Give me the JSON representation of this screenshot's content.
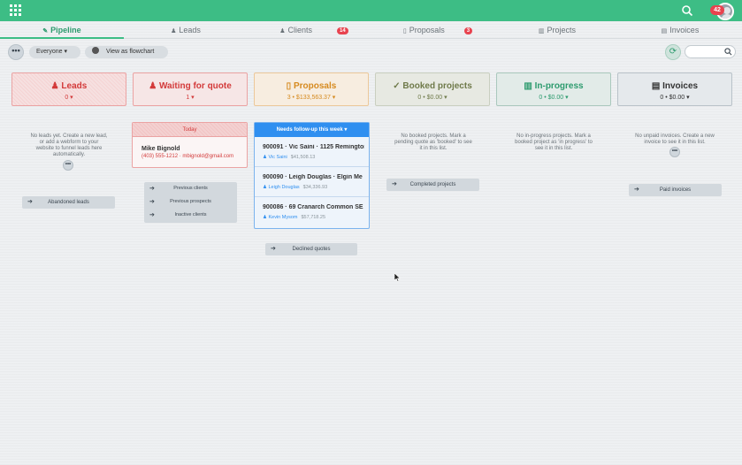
{
  "header": {
    "notification_count": "42",
    "icons": {
      "apps": "grid-icon",
      "search": "search-icon",
      "avatar": "user-avatar"
    },
    "colors": {
      "brand": "#3dbd85",
      "danger": "#e8434f",
      "info": "#2f8ff0"
    }
  },
  "tabs": [
    {
      "label": "Pipeline",
      "icon": "pipeline-icon",
      "active": true
    },
    {
      "label": "Leads",
      "icon": "person-icon"
    },
    {
      "label": "Clients",
      "icon": "person-icon",
      "badge": "14"
    },
    {
      "label": "Proposals",
      "icon": "document-icon",
      "badge": "3"
    },
    {
      "label": "Projects",
      "icon": "building-icon"
    },
    {
      "label": "Invoices",
      "icon": "document-icon"
    }
  ],
  "toolbar": {
    "more_label": "•••",
    "everyone_label": "Everyone ▾",
    "flowchart_label": "View as flowchart"
  },
  "stages": {
    "leads": {
      "name": "Leads",
      "value": "0 ▾"
    },
    "waiting": {
      "name": "Waiting for quote",
      "value": "1 ▾"
    },
    "proposals": {
      "name": "Proposals",
      "value": "3 • $133,563.37 ▾"
    },
    "booked": {
      "name": "Booked projects",
      "value": "0 • $0.00 ▾"
    },
    "progress": {
      "name": "In-progress",
      "value": "0 • $0.00 ▾"
    },
    "invoices": {
      "name": "Invoices",
      "value": "0 • $0.00 ▾"
    }
  },
  "leads_col": {
    "empty": "No leads yet. Create a new lead, or add a webform to your website to funnel leads here automatically.",
    "abandoned": "Abandoned leads"
  },
  "waiting_col": {
    "today": "Today",
    "name": "Mike Bignold",
    "contact": "(403) 555-1212 · mbignold@gmail.com",
    "links": [
      "Previous clients",
      "Previous prospects",
      "Inactive clients"
    ]
  },
  "proposals_col": {
    "filter": "Needs follow-up this week ▾",
    "quotes": [
      {
        "title": "900091 · Vic Saini · 1125 Remington",
        "client": "Vic Saini",
        "amount": "$41,508.13"
      },
      {
        "title": "900090 · Leigh Douglas · Elgin Me",
        "client": "Leigh Douglas",
        "amount": "$34,336.93"
      },
      {
        "title": "900086 · 69 Cranarch Common SE",
        "client": "Kevin Mysom",
        "amount": "$57,718.25"
      }
    ],
    "declined": "Declined quotes"
  },
  "booked_col": {
    "empty": "No booked projects. Mark a pending quote as 'booked' to see it in this list.",
    "completed": "Completed projects"
  },
  "progress_col": {
    "empty": "No in-progress projects. Mark a booked project as 'in progress' to see it in this list."
  },
  "invoices_col": {
    "empty": "No unpaid invoices. Create a new invoice to see it in this list.",
    "paid": "Paid invoices"
  }
}
